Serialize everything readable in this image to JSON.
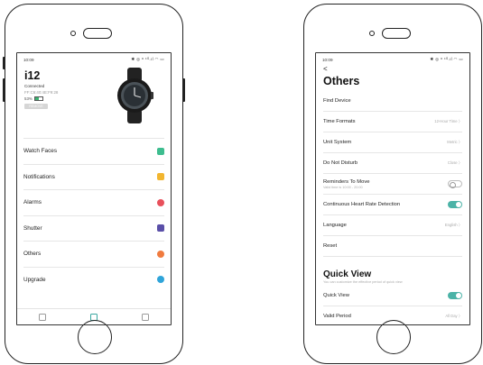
{
  "left_screen": {
    "status_time": "10:09",
    "status_icons": "✱ ◎ ᵃ ⁴ᴳ.ıl ◠ ▭",
    "device": {
      "name": "i12",
      "status": "Connected",
      "mac": "FF:C6:40:4E:F9:28",
      "battery_percent": "53%",
      "battery_level": 0.53,
      "remove_label": "REMOVE"
    },
    "menu": [
      {
        "label": "Watch Faces",
        "icon": "watch-faces-icon",
        "color": "#3dbd8f"
      },
      {
        "label": "Notifications",
        "icon": "notifications-icon",
        "color": "#f2b630"
      },
      {
        "label": "Alarms",
        "icon": "alarms-icon",
        "color": "#e8505b"
      },
      {
        "label": "Shutter",
        "icon": "shutter-icon",
        "color": "#5a4fa8"
      },
      {
        "label": "Others",
        "icon": "others-icon",
        "color": "#f07b3f"
      },
      {
        "label": "Upgrade",
        "icon": "upgrade-icon",
        "color": "#2fa4d9"
      }
    ],
    "tabbar": {
      "active_index": 1,
      "accent": "#3aa6a0"
    }
  },
  "right_screen": {
    "status_time": "10:09",
    "status_icons": "✱ ◎ ᵃ ⁴ᴳ.ıl ◠ ▭",
    "back_symbol": "<",
    "title": "Others",
    "rows": [
      {
        "label": "Find Device"
      },
      {
        "label": "Time Formats",
        "value": "12-Hour Time"
      },
      {
        "label": "Unit System",
        "value": "Metric"
      },
      {
        "label": "Do Not Disturb",
        "value": "Close"
      },
      {
        "label": "Reminders To Move",
        "sub": "Valid time is 10:00 - 20:00",
        "toggle": "off"
      },
      {
        "label": "Continuous Heart Rate Detection",
        "toggle": "on"
      },
      {
        "label": "Language",
        "value": "English"
      },
      {
        "label": "Reset"
      }
    ],
    "quick_view": {
      "title": "Quick View",
      "description": "You can customize the effective period of quick view",
      "rows": [
        {
          "label": "Quick View",
          "toggle": "on"
        },
        {
          "label": "Valid Period",
          "value": "All Day"
        }
      ]
    },
    "toggle_color": "#4bb3a7"
  }
}
